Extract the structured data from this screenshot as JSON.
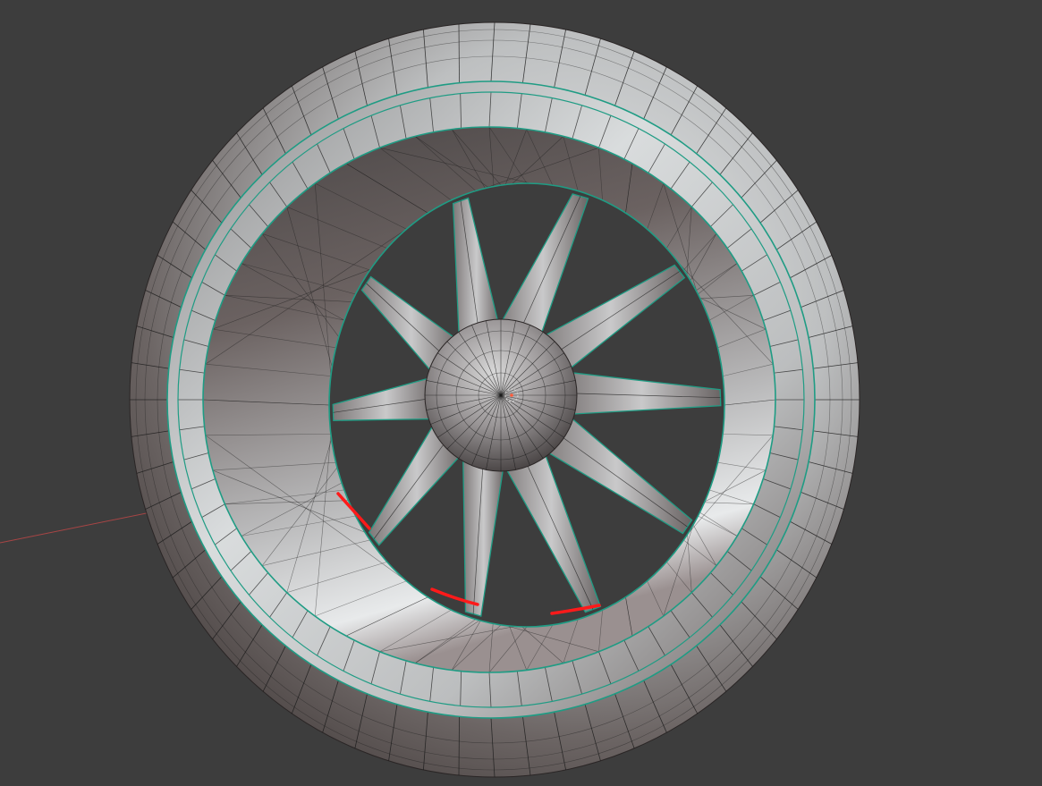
{
  "viewport": {
    "background": "#3d3d3d",
    "shading": "solid",
    "mode": "edit"
  },
  "model": {
    "object": "ducted-fan",
    "spoke_count": 10,
    "outer_ring_segments": 64,
    "hub_segments": 32,
    "colors": {
      "wire": "#1a1a1a",
      "seam": "#1f9c84",
      "highlight": "#ff1a1a",
      "x_axis": "#a84545"
    }
  },
  "icons": {
    "origin": "origin-pivot-icon"
  }
}
